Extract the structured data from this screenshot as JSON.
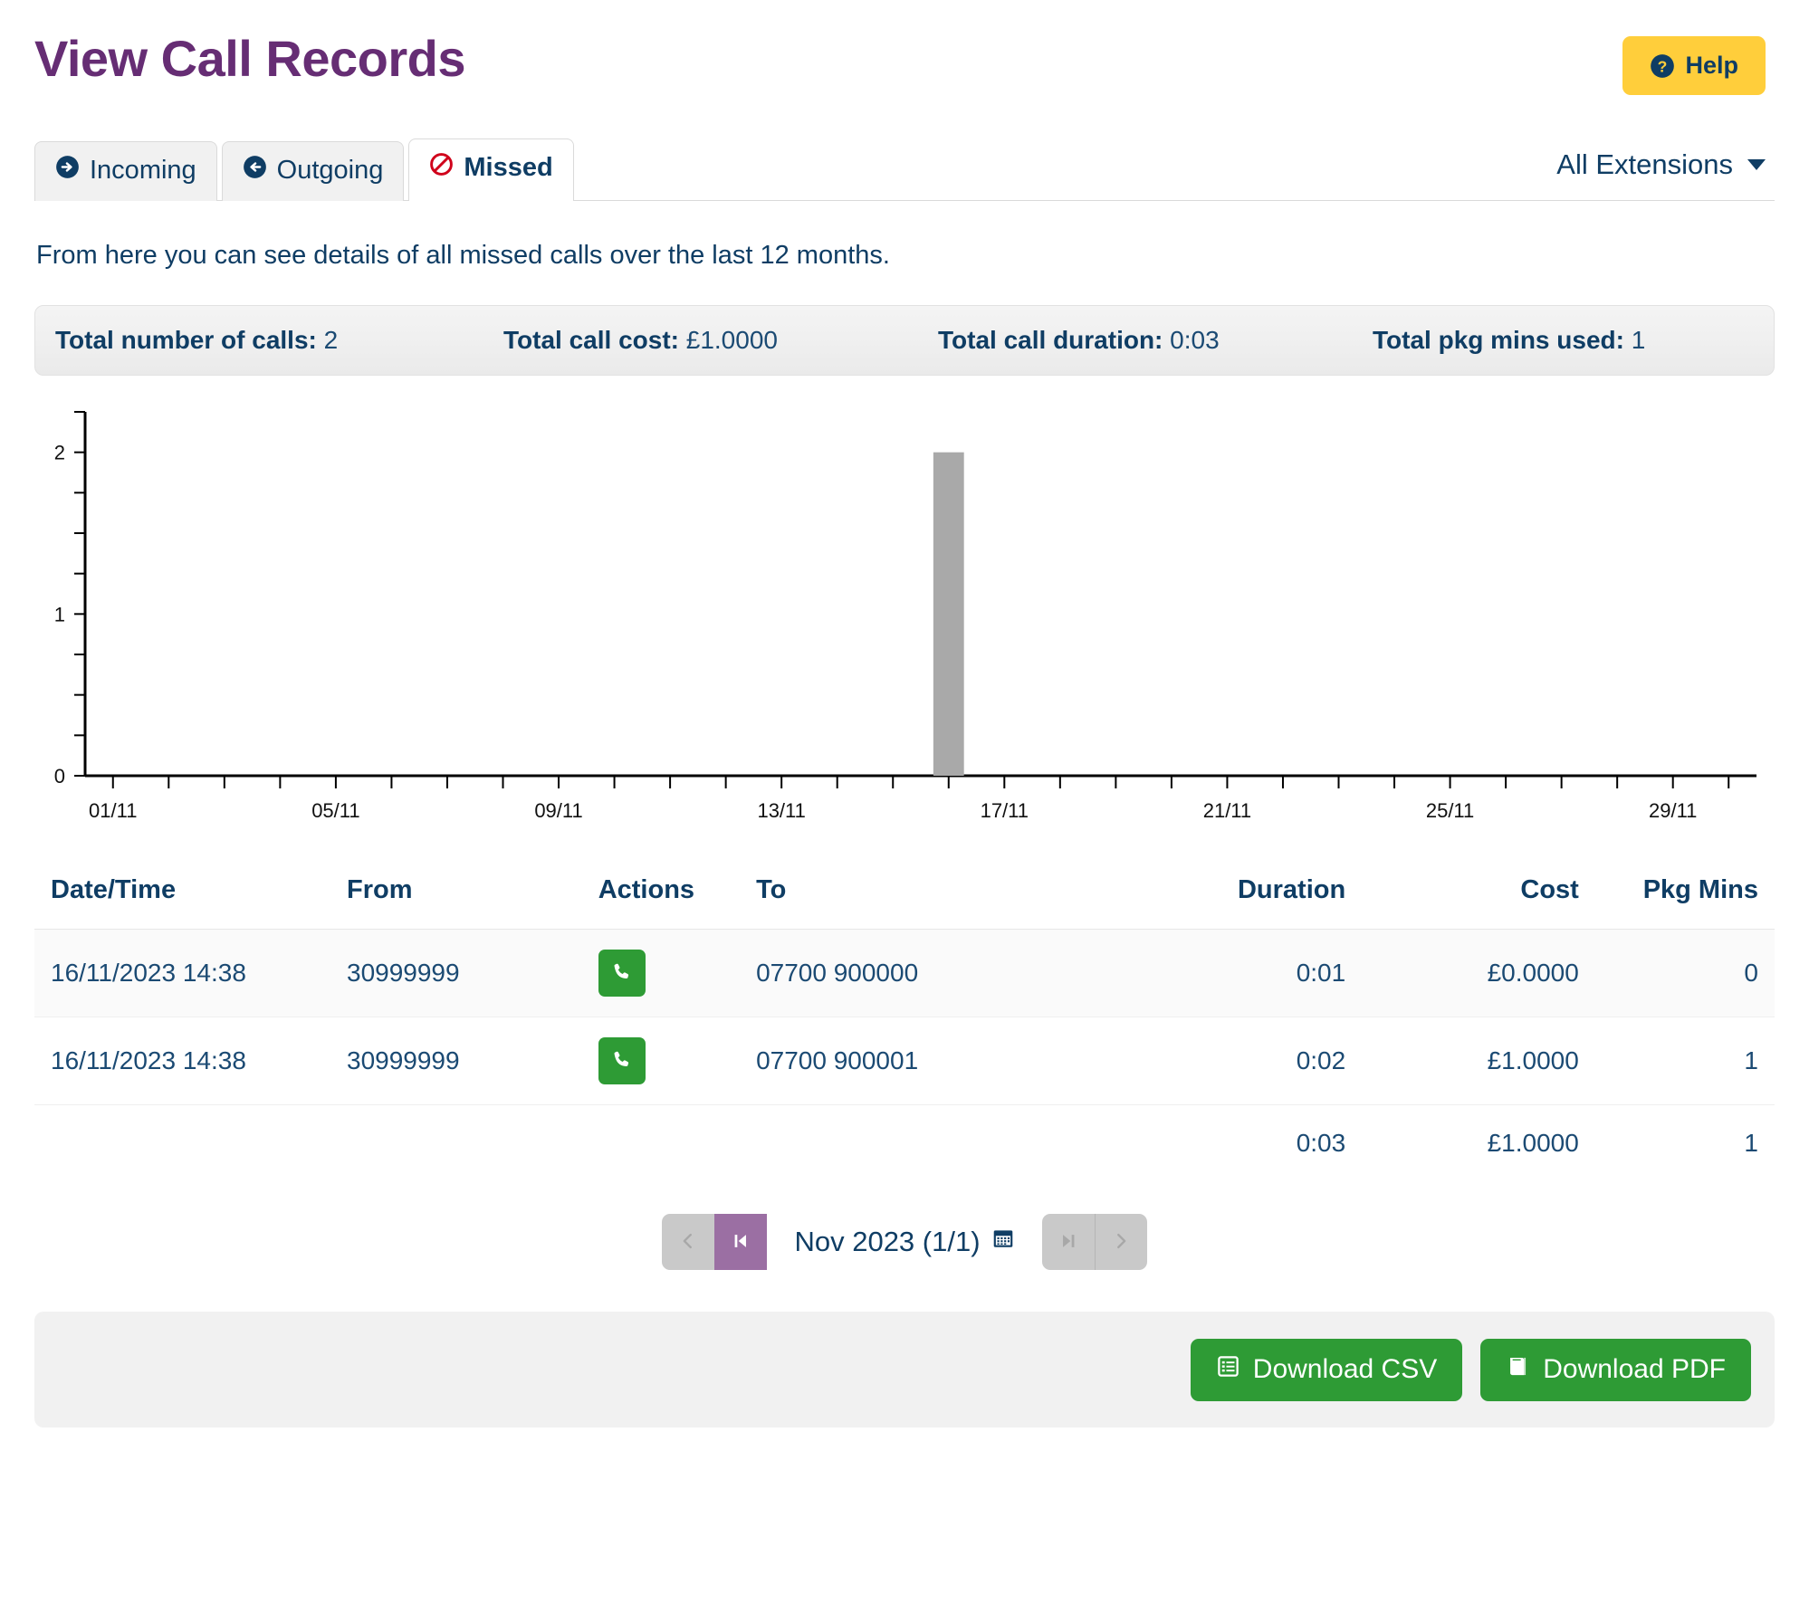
{
  "header": {
    "title": "View Call Records",
    "help_label": "Help",
    "help_icon": "question-circle-icon"
  },
  "tabs": [
    {
      "label": "Incoming",
      "icon": "arrow-circle-right-icon",
      "active": false
    },
    {
      "label": "Outgoing",
      "icon": "arrow-circle-left-icon",
      "active": false
    },
    {
      "label": "Missed",
      "icon": "ban-icon",
      "active": true
    }
  ],
  "extension_filter": {
    "label": "All Extensions",
    "icon": "chevron-down-icon"
  },
  "intro": "From here you can see details of all missed calls over the last 12 months.",
  "summary": {
    "calls_label": "Total number of calls:",
    "calls_value": "2",
    "cost_label": "Total call cost:",
    "cost_value": "£1.0000",
    "duration_label": "Total call duration:",
    "duration_value": "0:03",
    "pkg_label": "Total pkg mins used:",
    "pkg_value": "1"
  },
  "chart_data": {
    "type": "bar",
    "title": "",
    "xlabel": "",
    "ylabel": "",
    "categories": [
      "01/11",
      "02/11",
      "03/11",
      "04/11",
      "05/11",
      "06/11",
      "07/11",
      "08/11",
      "09/11",
      "10/11",
      "11/11",
      "12/11",
      "13/11",
      "14/11",
      "15/11",
      "16/11",
      "17/11",
      "18/11",
      "19/11",
      "20/11",
      "21/11",
      "22/11",
      "23/11",
      "24/11",
      "25/11",
      "26/11",
      "27/11",
      "28/11",
      "29/11",
      "30/11"
    ],
    "values": [
      0,
      0,
      0,
      0,
      0,
      0,
      0,
      0,
      0,
      0,
      0,
      0,
      0,
      0,
      0,
      2,
      0,
      0,
      0,
      0,
      0,
      0,
      0,
      0,
      0,
      0,
      0,
      0,
      0,
      0
    ],
    "tick_labels": [
      "01/11",
      "05/11",
      "09/11",
      "13/11",
      "17/11",
      "21/11",
      "25/11",
      "29/11"
    ],
    "tick_indices": [
      0,
      4,
      8,
      12,
      16,
      20,
      24,
      28
    ],
    "y_ticks": [
      0,
      1,
      2
    ],
    "ylim": [
      0,
      2.25
    ],
    "grid": false,
    "legend": "none",
    "bar_color": "#a9a9a9"
  },
  "table": {
    "columns": [
      "Date/Time",
      "From",
      "Actions",
      "To",
      "Duration",
      "Cost",
      "Pkg Mins"
    ],
    "rows": [
      {
        "datetime": "16/11/2023 14:38",
        "from": "30999999",
        "action_icon": "phone-icon",
        "to": "07700 900000",
        "duration": "0:01",
        "cost": "£0.0000",
        "pkg": "0"
      },
      {
        "datetime": "16/11/2023 14:38",
        "from": "30999999",
        "action_icon": "phone-icon",
        "to": "07700 900001",
        "duration": "0:02",
        "cost": "£1.0000",
        "pkg": "1"
      }
    ],
    "totals": {
      "duration": "0:03",
      "cost": "£1.0000",
      "pkg": "1"
    }
  },
  "pagination": {
    "prev_icon": "chevron-left-icon",
    "first_icon": "step-backward-icon",
    "label": "Nov 2023 (1/1)",
    "calendar_icon": "calendar-icon",
    "last_icon": "step-forward-icon",
    "next_icon": "chevron-right-icon"
  },
  "footer": {
    "csv_label": "Download CSV",
    "csv_icon": "list-alt-icon",
    "pdf_label": "Download PDF",
    "pdf_icon": "book-icon"
  },
  "colors": {
    "title_purple": "#662D74",
    "navy": "#0F3D64",
    "help_yellow": "#FFCE3B",
    "green": "#2E9B35",
    "active_page_purple": "#9B6FA3",
    "bar_gray": "#a9a9a9",
    "missed_red": "#d0021b"
  }
}
